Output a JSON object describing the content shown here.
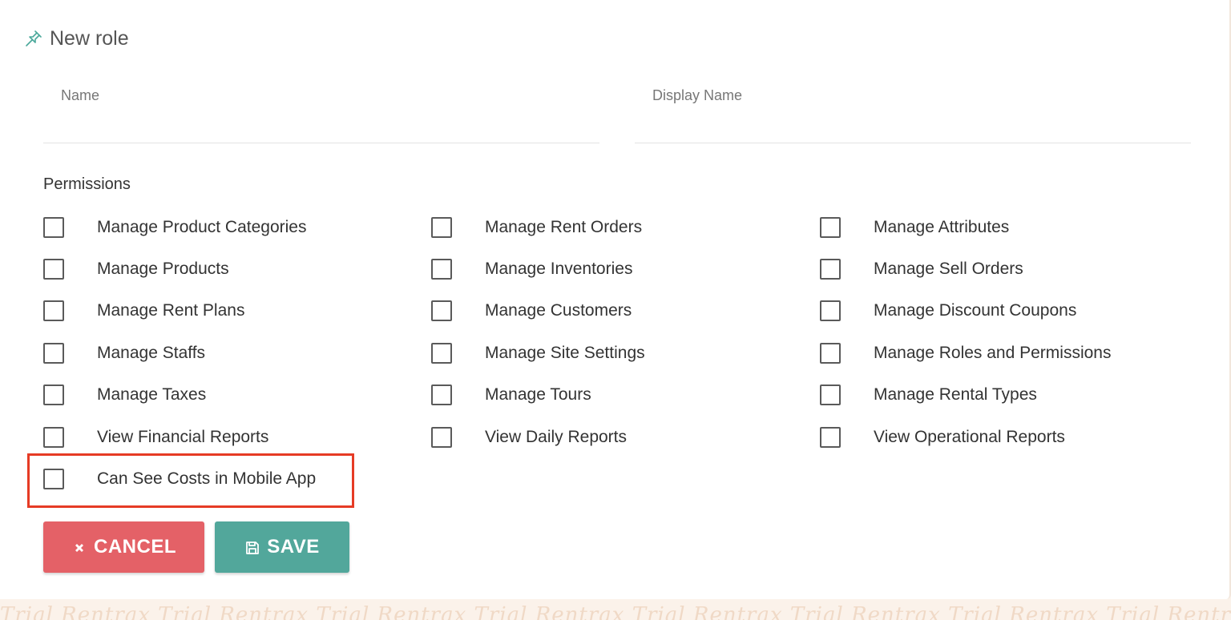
{
  "header": {
    "title": "New role",
    "icon": "pin-icon",
    "accent": "#4aa89b"
  },
  "form": {
    "name_label": "Name",
    "name_value": "",
    "display_name_label": "Display Name",
    "display_name_value": ""
  },
  "permissions": {
    "title": "Permissions",
    "items": [
      {
        "label": "Manage Product Categories",
        "checked": false
      },
      {
        "label": "Manage Rent Orders",
        "checked": false
      },
      {
        "label": "Manage Attributes",
        "checked": false
      },
      {
        "label": "Manage Products",
        "checked": false
      },
      {
        "label": "Manage Inventories",
        "checked": false
      },
      {
        "label": "Manage Sell Orders",
        "checked": false
      },
      {
        "label": "Manage Rent Plans",
        "checked": false
      },
      {
        "label": "Manage Customers",
        "checked": false
      },
      {
        "label": "Manage Discount Coupons",
        "checked": false
      },
      {
        "label": "Manage Staffs",
        "checked": false
      },
      {
        "label": "Manage Site Settings",
        "checked": false
      },
      {
        "label": "Manage Roles and Permissions",
        "checked": false
      },
      {
        "label": "Manage Taxes",
        "checked": false
      },
      {
        "label": "Manage Tours",
        "checked": false
      },
      {
        "label": "Manage Rental Types",
        "checked": false
      },
      {
        "label": "View Financial Reports",
        "checked": false
      },
      {
        "label": "View Daily Reports",
        "checked": false
      },
      {
        "label": "View Operational Reports",
        "checked": false
      },
      {
        "label": "Can See Costs in Mobile App",
        "checked": false
      }
    ]
  },
  "actions": {
    "cancel_label": "CANCEL",
    "cancel_icon": "close-icon",
    "cancel_color": "#e46167",
    "save_label": "SAVE",
    "save_icon": "floppy-disk-icon",
    "save_color": "#52a79b"
  },
  "watermark": {
    "text": "Trial Rentrax Trial Rentrax Trial Rentrax Trial Rentrax Trial Rentrax Trial Rentrax Trial Rentrax Trial Rentrax Trial"
  },
  "highlight_color": "#e63b25"
}
